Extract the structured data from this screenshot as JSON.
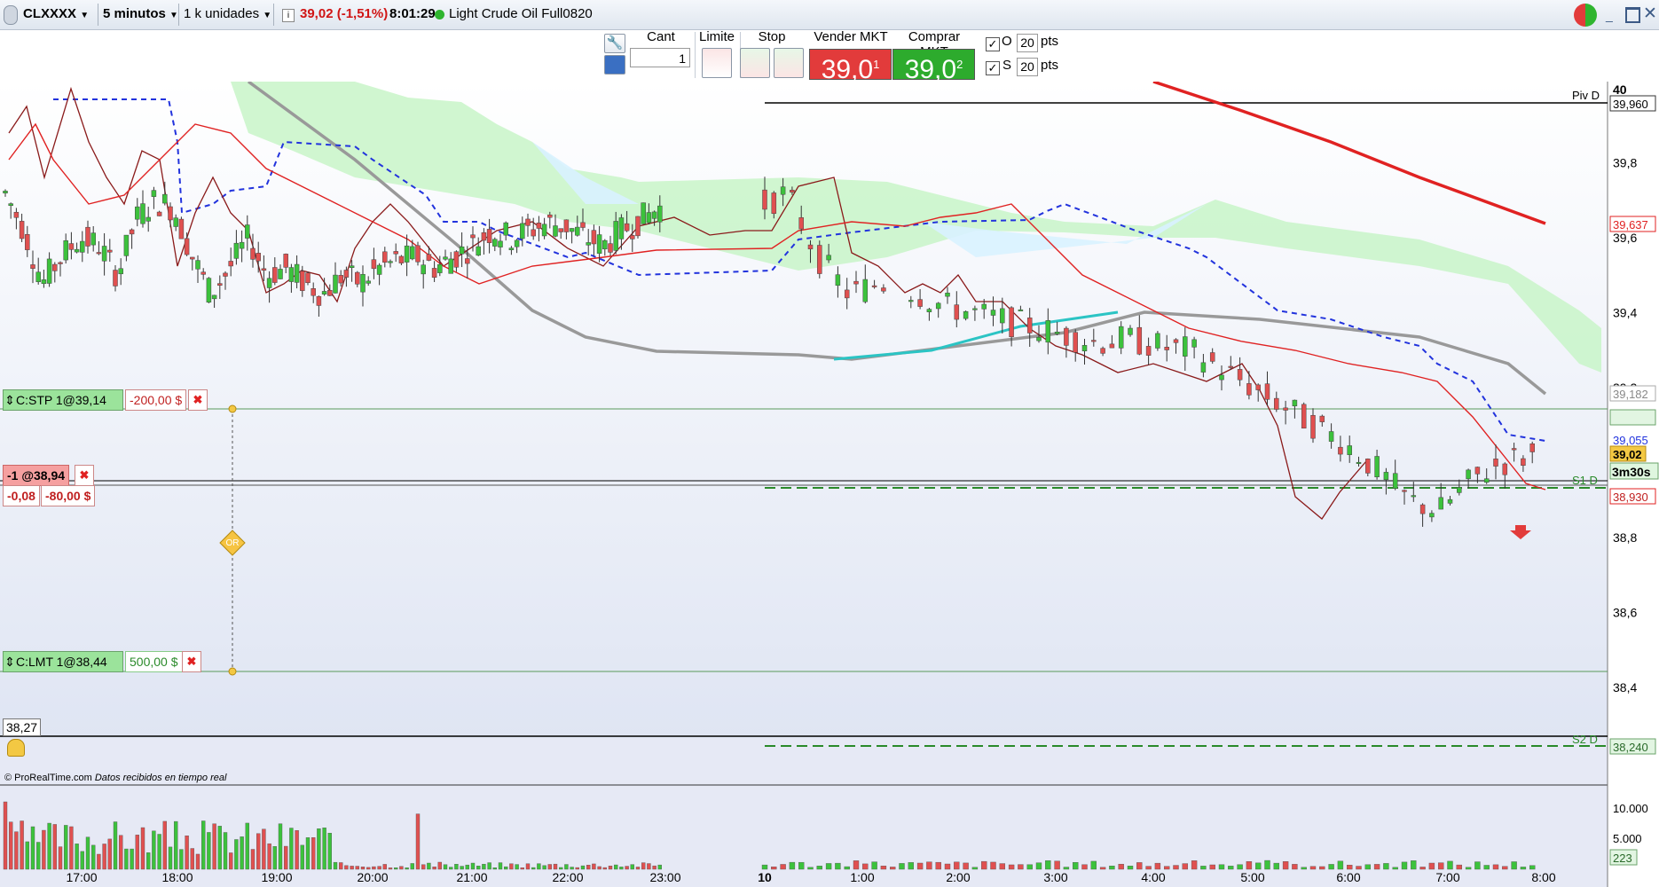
{
  "titlebar": {
    "symbol": "CLXXXX",
    "interval": "5 minutos",
    "units": "1 k unidades",
    "info_icon": "info-icon",
    "quote": "39,02 (-1,51%)",
    "time": "8:01:29",
    "instrument": "Light Crude Oil Full0820"
  },
  "toolbar": {
    "cant_label": "Cant",
    "cant_value": "1",
    "limit_label": "Limite",
    "stop_label": "Stop",
    "sell_label": "Vender MKT",
    "buy_label": "Comprar MKT",
    "sell_price_main": "39,0",
    "sell_price_sup": "1",
    "buy_price_main": "39,0",
    "buy_price_sup": "2",
    "o_label": "O",
    "o_value": "20",
    "s_label": "S",
    "s_value": "20",
    "pts_label": "pts",
    "colors": {
      "sell": "#e23b3b",
      "buy": "#2dab2d"
    }
  },
  "orders": {
    "stop_label": "C:STP 1@39,14",
    "stop_pnl": "-200,00 $",
    "position_label": "-1 @38,94",
    "position_diff": "-0,08",
    "position_pnl": "-80,00 $",
    "limit_label": "C:LMT 1@38,44",
    "limit_pnl": "500,00 $",
    "oco_label": "OR",
    "low_value": "38,27"
  },
  "axis": {
    "y_ticks": [
      "40",
      "39,8",
      "39,6",
      "39,4",
      "39,2",
      "38,8",
      "38,6",
      "38,4"
    ],
    "x_ticks": [
      "17:00",
      "18:00",
      "19:00",
      "20:00",
      "21:00",
      "22:00",
      "23:00",
      "10",
      "1:00",
      "2:00",
      "3:00",
      "4:00",
      "5:00",
      "6:00",
      "7:00",
      "8:00"
    ],
    "price_tags": {
      "piv": "39,960",
      "red_ma": "39,637",
      "gray_ma": "39,182",
      "blue": "39,055",
      "last": "39,02",
      "countdown": "3m30s",
      "s1": "38,930",
      "s2": "38,240"
    },
    "levels": {
      "piv": "Piv D",
      "s1": "S1 D",
      "s2": "S2 D"
    },
    "volume_ticks": [
      "10.000",
      "5.000"
    ],
    "volume_last": "223"
  },
  "footer": {
    "brand": "© ProRealTime.com",
    "status": "Datos recibidos en tiempo real"
  },
  "chart_data": {
    "type": "candlestick",
    "y_range": [
      38.2,
      40.05
    ],
    "closes": [
      39.72,
      39.62,
      39.48,
      39.55,
      39.6,
      39.58,
      39.5,
      39.65,
      39.7,
      39.68,
      39.55,
      39.45,
      39.52,
      39.6,
      39.5,
      39.52,
      39.48,
      39.45,
      39.5,
      39.48,
      39.52,
      39.54,
      39.55,
      39.52,
      39.55,
      39.58,
      39.62,
      39.6,
      39.62,
      39.64,
      39.63,
      39.6,
      39.58,
      39.62,
      39.65,
      39.68,
      39.72,
      39.55,
      39.45,
      39.48,
      39.46,
      39.42,
      39.4,
      39.38,
      39.36,
      39.34,
      39.32,
      39.33,
      39.31,
      39.3,
      39.25,
      39.2,
      39.15,
      39.1,
      39.05,
      38.98,
      38.9,
      38.87,
      38.95,
      39.0,
      39.02
    ],
    "ma_fast_series_color": "#e03030",
    "ma_slow_series_color": "#999999"
  }
}
